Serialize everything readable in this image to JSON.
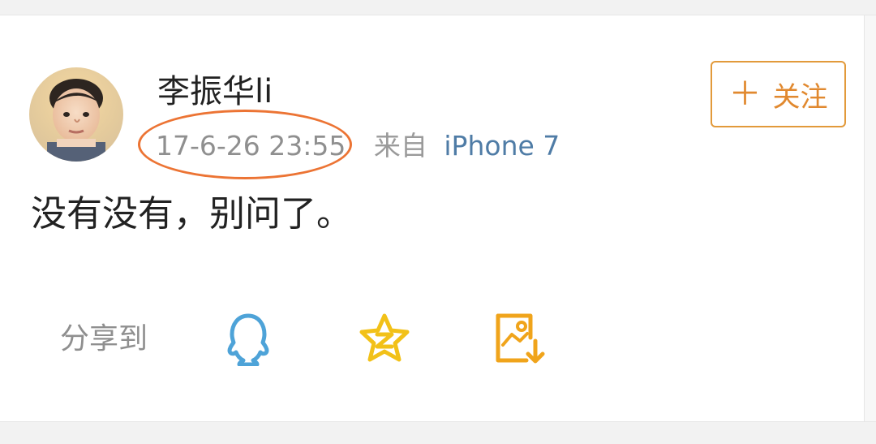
{
  "post": {
    "username": "李振华li",
    "time": "17-6-26 23:55",
    "from_label": "来自",
    "device": "iPhone 7",
    "content": "没有没有，别问了。"
  },
  "actions": {
    "follow_label": "关注",
    "share_label": "分享到"
  },
  "icons": {
    "follow": "plus-icon",
    "share_qq": "qq-icon",
    "share_qzone": "qzone-icon",
    "share_save_image": "save-image-icon"
  },
  "colors": {
    "accent": "#e1892f",
    "qq_blue": "#4ea3d8",
    "qzone_yellow": "#f2c118",
    "save_orange": "#f0a41b",
    "device_blue": "#4f7ca6",
    "annotation_orange": "#ec7434"
  }
}
